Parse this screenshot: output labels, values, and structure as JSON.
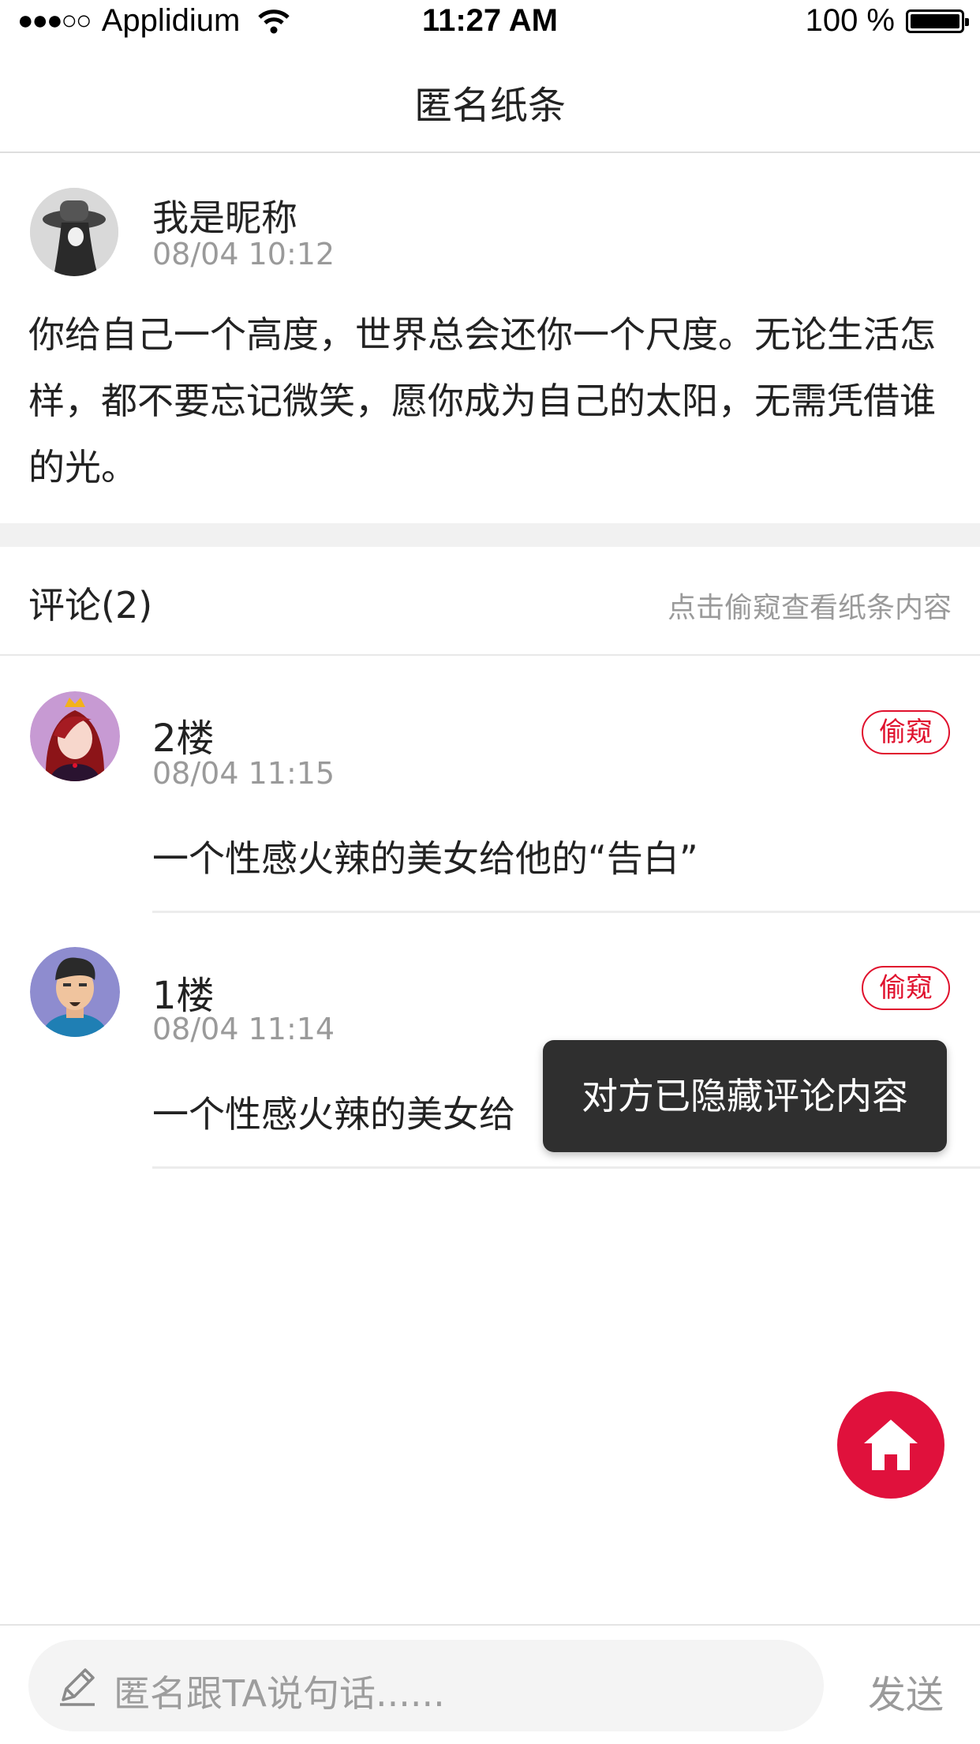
{
  "status_bar": {
    "carrier": "Applidium",
    "time": "11:27 AM",
    "battery": "100 %"
  },
  "nav": {
    "title": "匿名纸条"
  },
  "post": {
    "name": "我是昵称",
    "time": "08/04   10:12",
    "body": "你给自己一个高度，世界总会还你一个尺度。无论生活怎样，都不要忘记微笑，愿你成为自己的太阳，无需凭借谁的光。"
  },
  "comments_header": {
    "title": "评论(2)",
    "hint": "点击偷窥查看纸条内容"
  },
  "comments": [
    {
      "floor": "2楼",
      "time": "08/04   11:15",
      "text": "一个性感火辣的美女给他的“告白”",
      "peek_label": "偷窥"
    },
    {
      "floor": "1楼",
      "time": "08/04   11:14",
      "text": "一个性感火辣的美女给",
      "peek_label": "偷窥"
    }
  ],
  "toast": {
    "message": "对方已隐藏评论内容"
  },
  "bottom": {
    "placeholder": "匿名跟TA说句话......",
    "send_label": "发送"
  },
  "colors": {
    "accent": "#e0112d",
    "fab": "#e0113c"
  }
}
